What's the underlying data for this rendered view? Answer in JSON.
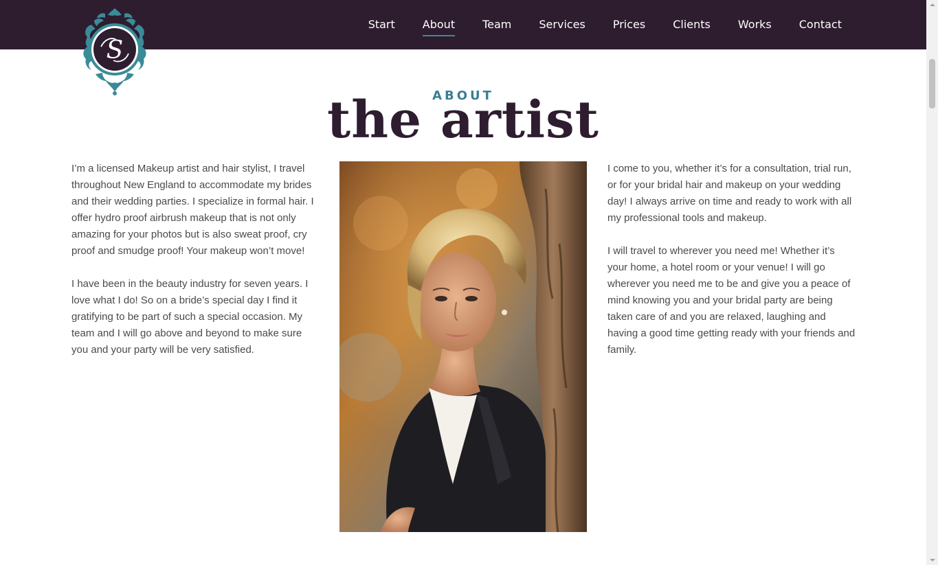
{
  "nav": {
    "items": [
      {
        "label": "Start"
      },
      {
        "label": "About",
        "active": true
      },
      {
        "label": "Team"
      },
      {
        "label": "Services"
      },
      {
        "label": "Prices"
      },
      {
        "label": "Clients"
      },
      {
        "label": "Works"
      },
      {
        "label": "Contact"
      }
    ]
  },
  "logo": {
    "monogram": "S",
    "icon": "ornate-monogram-logo"
  },
  "section": {
    "kicker": "ABOUT",
    "title": "the artist"
  },
  "left_column": {
    "paragraphs": [
      "I’m a licensed Makeup artist and hair stylist, I travel throughout New England to accommodate my brides and their wedding parties. I specialize in formal hair. I offer hydro proof airbrush makeup that is not only amazing for your photos but is also sweat proof, cry proof and smudge proof! Your makeup won’t move!",
      "I have been in the beauty industry for seven years. I love what I do! So on a bride’s special day I find it gratifying to be part of such a special occasion. My team and I will go above and beyond to make sure you and your party will be very satisfied."
    ]
  },
  "right_column": {
    "paragraphs": [
      "I come to you, whether it’s for a consultation, trial run, or for your bridal hair and makeup on your wedding day! I always arrive on time and ready to work with all my professional tools and makeup.",
      "I will travel to wherever you need me! Whether it’s your home, a hotel room or your venue! I will go wherever you need me to be and give you a peace of mind knowing you and your bridal party are being taken care of and you are relaxed, laughing and having a good time getting ready with your friends and family."
    ]
  },
  "colors": {
    "navbar": "#2e1c2f",
    "accent": "#3a8b97",
    "title": "#2e1c2f",
    "body_text": "#4a4a4a"
  }
}
